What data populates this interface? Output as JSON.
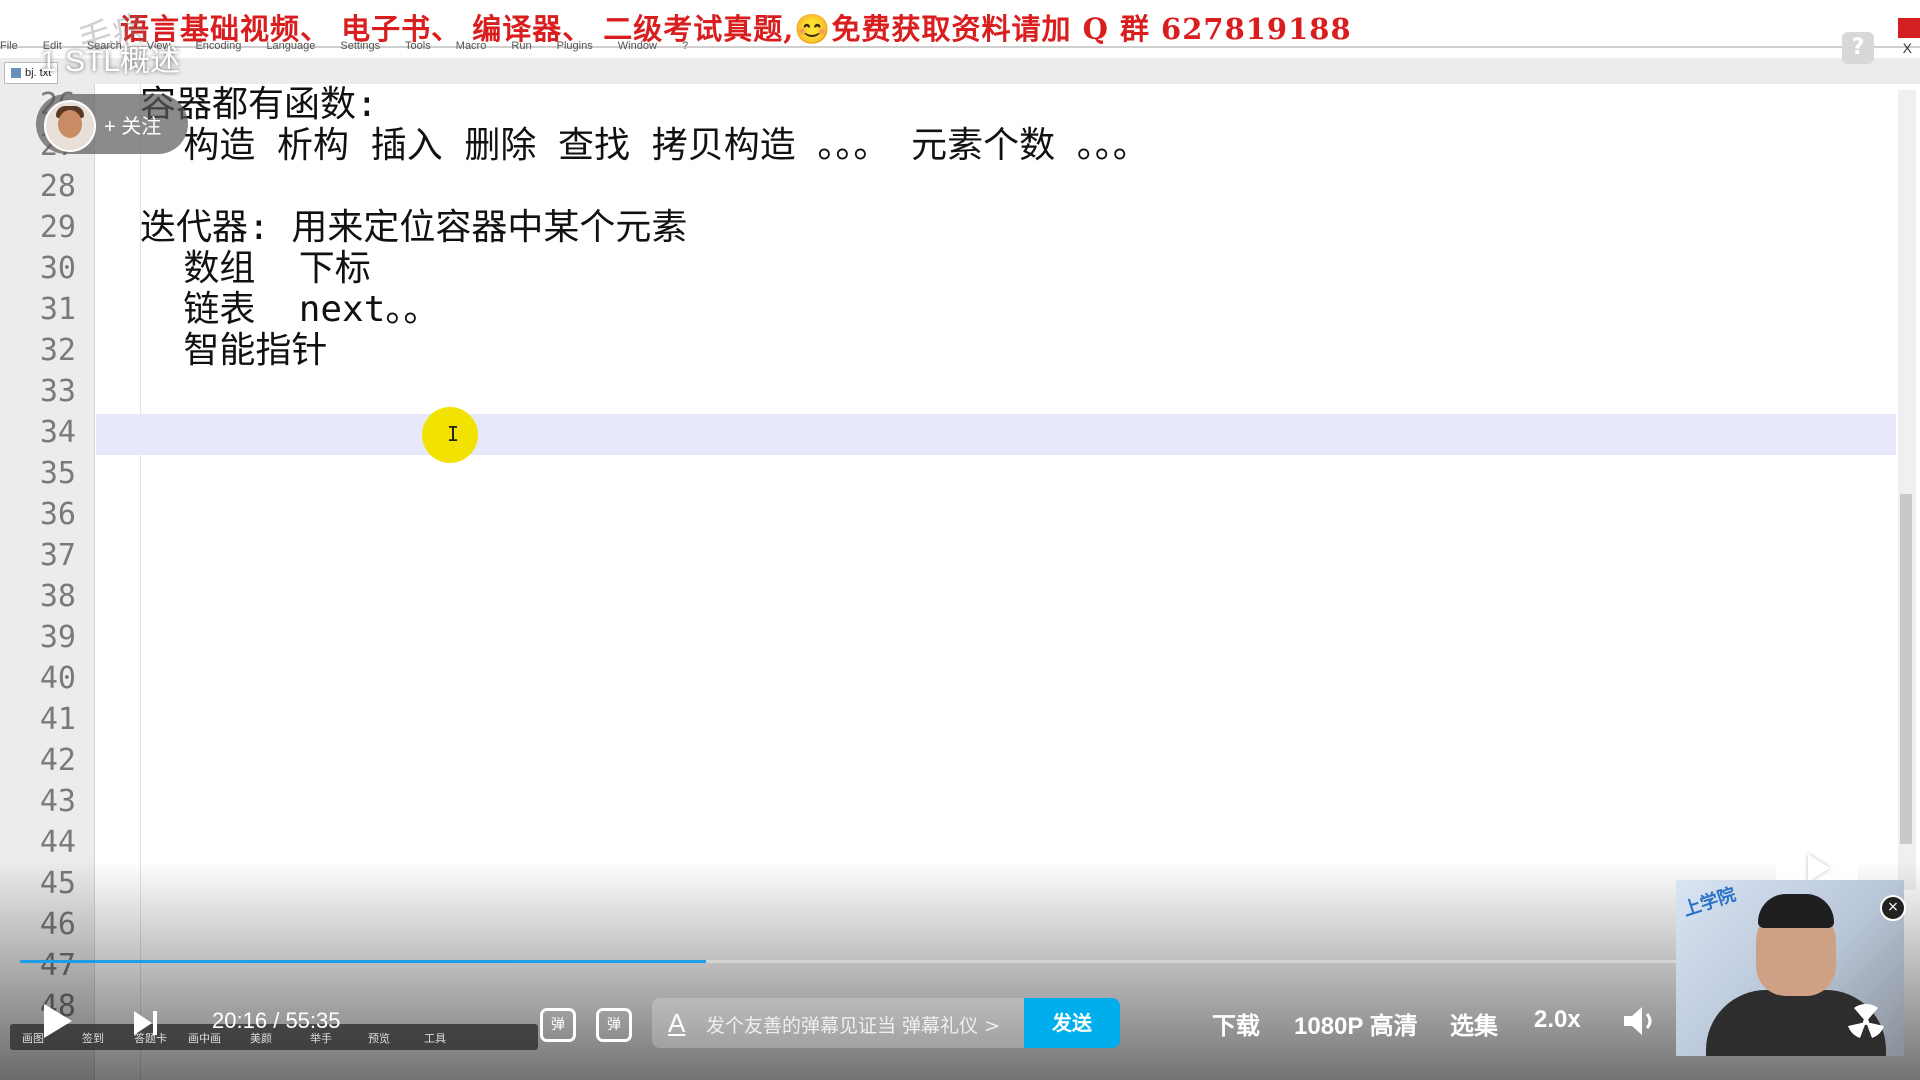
{
  "banner": {
    "text": "语言基础视频、 电子书、 编译器、 二级考试真题,😊免费获取资料请加 Q 群 627819188"
  },
  "menu": [
    "File",
    "Edit",
    "Search",
    "View",
    "Encoding",
    "Language",
    "Settings",
    "Tools",
    "Macro",
    "Run",
    "Plugins",
    "Window",
    "?"
  ],
  "window": {
    "close": "X"
  },
  "file_tab": {
    "label": "bj. txt"
  },
  "video": {
    "title": "1 STL概述",
    "watermark": "毛病"
  },
  "help": {
    "label": "?"
  },
  "follow": {
    "label": "+ 关注"
  },
  "editor": {
    "line_numbers": [
      "26",
      "27",
      "28",
      "29",
      "30",
      "31",
      "32",
      "33",
      "34",
      "35",
      "36",
      "37",
      "38",
      "39",
      "40",
      "41",
      "42",
      "43",
      "44",
      "45",
      "46",
      "47",
      "48"
    ],
    "lines": [
      "容器都有函数:",
      "  构造 析构 插入 删除 查找 拷贝构造 。。。 元素个数 。。。",
      "",
      "迭代器: 用来定位容器中某个元素",
      "  数组  下标",
      "  链表  next。。",
      "  智能指针",
      "",
      ""
    ],
    "current_line": "34",
    "cursor_glyph": "I"
  },
  "player": {
    "progress_fraction": 0.3647,
    "time_current": "20:16",
    "time_separator": "/",
    "time_total": "55:35",
    "danmaku_input_placeholder": "发个友善的弹幕见证当 弹幕礼仪 >",
    "danmaku_icon_a": "A",
    "danmaku_toggle_label": "弹",
    "danmaku_settings_label": "弹",
    "send_label": "发送",
    "download_label": "下载",
    "quality_label": "1080P 高清",
    "episodes_label": "选集",
    "speed_label": "2.0x",
    "pip_logo": "上学院",
    "pip_close": "×"
  },
  "taskbar": {
    "items": [
      "画图",
      "签到",
      "答题卡",
      "画中画",
      "美颜",
      "举手",
      "预览",
      "工具"
    ]
  },
  "colors": {
    "banner_red": "#d81e1e",
    "accent_blue": "#00aeec",
    "current_line_bg": "#e8e8fb",
    "cursor_highlight": "#f2e200"
  }
}
